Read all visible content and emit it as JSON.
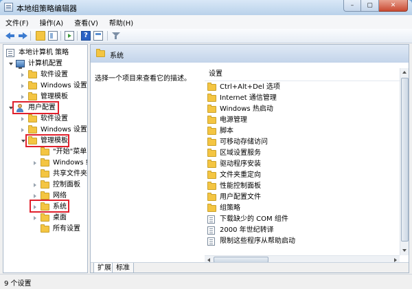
{
  "window": {
    "title": "本地组策略编辑器"
  },
  "window_controls": {
    "minimize": "–",
    "maximize": "▢",
    "close": "✕"
  },
  "menu": [
    "文件(F)",
    "操作(A)",
    "查看(V)",
    "帮助(H)"
  ],
  "tree": {
    "root": "本地计算机 策略",
    "computer_config": "计算机配置",
    "computer_children": [
      "软件设置",
      "Windows 设置",
      "管理模板"
    ],
    "user_config": "用户配置",
    "user_children": [
      "软件设置",
      "Windows 设置"
    ],
    "admin_templates": "管理模板",
    "admin_children": [
      "\"开始\"菜单",
      "Windows 组",
      "共享文件夹",
      "控制面板",
      "网络"
    ],
    "system": "系统",
    "after_system": [
      "桌面",
      "所有设置"
    ]
  },
  "right": {
    "header_title": "系统",
    "description": "选择一个项目来查看它的描述。",
    "column_header": "设置",
    "folders": [
      "Ctrl+Alt+Del 选项",
      "Internet 通信管理",
      "Windows 热启动",
      "电源管理",
      "脚本",
      "可移动存储访问",
      "区域设置服务",
      "驱动程序安装",
      "文件夹重定向",
      "性能控制面板",
      "用户配置文件",
      "组策略"
    ],
    "settings": [
      "下载缺少的 COM 组件",
      "2000 年世纪转译",
      "限制这些程序从帮助启动"
    ]
  },
  "tabs": [
    "扩展",
    "标准"
  ],
  "status": "9 个设置",
  "colors": {
    "highlight": "#e01f2b",
    "folder": "#f4c542",
    "header": "#c3d4ea"
  }
}
